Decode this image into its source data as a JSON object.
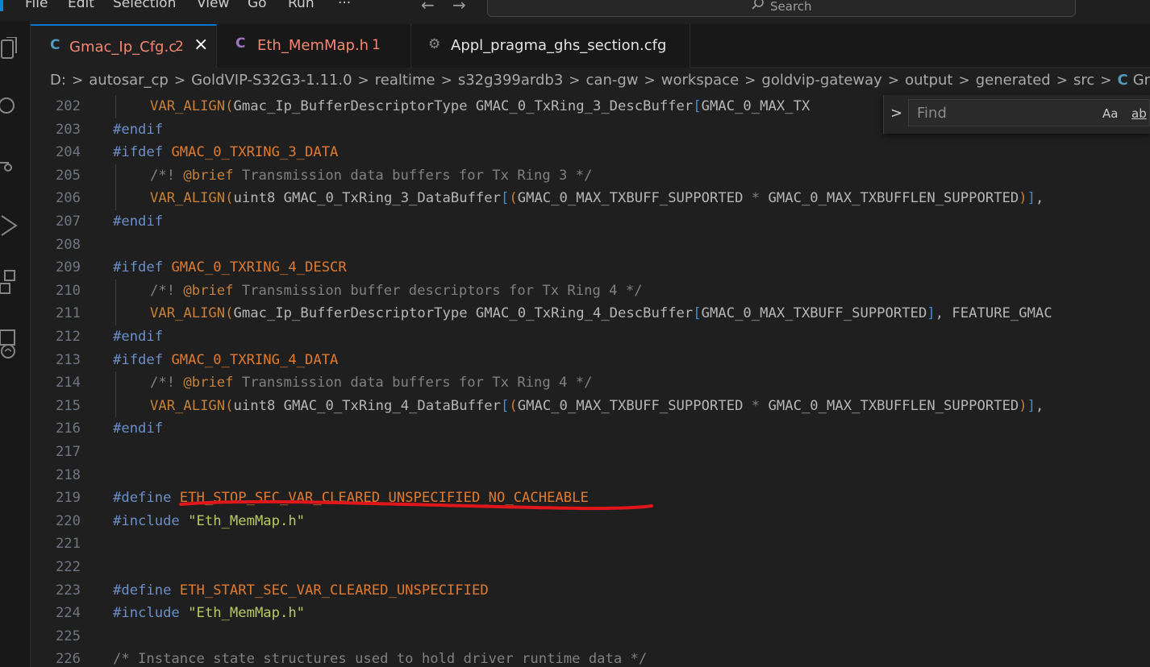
{
  "menu": [
    "File",
    "Edit",
    "Selection",
    "View",
    "Go",
    "Run",
    "···"
  ],
  "search": {
    "placeholder": "Search"
  },
  "tabs": [
    {
      "icon": "C",
      "label": "Gmac_Ip_Cfg.c",
      "count": "2",
      "active": true,
      "color": "#f48771"
    },
    {
      "icon": "C",
      "label": "Eth_MemMap.h",
      "count": "1",
      "active": false,
      "color": "#f48771"
    },
    {
      "icon": "gear",
      "label": "Appl_pragma_ghs_section.cfg",
      "count": "",
      "active": false,
      "color": "#cccccc"
    }
  ],
  "breadcrumb": [
    "D:",
    "autosar_cp",
    "GoldVIP-S32G3-1.11.0",
    "realtime",
    "s32g399ardb3",
    "can-gw",
    "workspace",
    "goldvip-gateway",
    "output",
    "generated",
    "src",
    "Gmac_Ip_Cfg"
  ],
  "find": {
    "placeholder": "Find",
    "opt_case": "Aa",
    "opt_word": "ab"
  },
  "lines": [
    {
      "n": "202",
      "indent": true,
      "t": "VAR_ALIGN(Gmac_Ip_BufferDescriptorType GMAC_0_TxRing_3_DescBuffer[GMAC_0_MAX_TX"
    },
    {
      "n": "203",
      "indent": false,
      "t": "#endif"
    },
    {
      "n": "204",
      "indent": false,
      "t": "#ifdef GMAC_0_TXRING_3_DATA"
    },
    {
      "n": "205",
      "indent": true,
      "t": "/*! @brief Transmission data buffers for Tx Ring 3 */"
    },
    {
      "n": "206",
      "indent": true,
      "t": "VAR_ALIGN(uint8 GMAC_0_TxRing_3_DataBuffer[(GMAC_0_MAX_TXBUFF_SUPPORTED * GMAC_0_MAX_TXBUFFLEN_SUPPORTED)],"
    },
    {
      "n": "207",
      "indent": false,
      "t": "#endif"
    },
    {
      "n": "208",
      "indent": false,
      "t": ""
    },
    {
      "n": "209",
      "indent": false,
      "t": "#ifdef GMAC_0_TXRING_4_DESCR"
    },
    {
      "n": "210",
      "indent": true,
      "t": "/*! @brief Transmission buffer descriptors for Tx Ring 4 */"
    },
    {
      "n": "211",
      "indent": true,
      "t": "VAR_ALIGN(Gmac_Ip_BufferDescriptorType GMAC_0_TxRing_4_DescBuffer[GMAC_0_MAX_TXBUFF_SUPPORTED], FEATURE_GMAC"
    },
    {
      "n": "212",
      "indent": false,
      "t": "#endif"
    },
    {
      "n": "213",
      "indent": false,
      "t": "#ifdef GMAC_0_TXRING_4_DATA"
    },
    {
      "n": "214",
      "indent": true,
      "t": "/*! @brief Transmission data buffers for Tx Ring 4 */"
    },
    {
      "n": "215",
      "indent": true,
      "t": "VAR_ALIGN(uint8 GMAC_0_TxRing_4_DataBuffer[(GMAC_0_MAX_TXBUFF_SUPPORTED * GMAC_0_MAX_TXBUFFLEN_SUPPORTED)],"
    },
    {
      "n": "216",
      "indent": false,
      "t": "#endif"
    },
    {
      "n": "217",
      "indent": false,
      "t": ""
    },
    {
      "n": "218",
      "indent": false,
      "t": ""
    },
    {
      "n": "219",
      "indent": false,
      "t": "#define ETH_STOP_SEC_VAR_CLEARED_UNSPECIFIED_NO_CACHEABLE"
    },
    {
      "n": "220",
      "indent": false,
      "t": "#include \"Eth_MemMap.h\""
    },
    {
      "n": "221",
      "indent": false,
      "t": ""
    },
    {
      "n": "222",
      "indent": false,
      "t": ""
    },
    {
      "n": "223",
      "indent": false,
      "t": "#define ETH_START_SEC_VAR_CLEARED_UNSPECIFIED"
    },
    {
      "n": "224",
      "indent": false,
      "t": "#include \"Eth_MemMap.h\""
    },
    {
      "n": "225",
      "indent": false,
      "t": ""
    },
    {
      "n": "226",
      "indent": false,
      "t": "/* Instance state structures used to hold driver runtime data */"
    }
  ],
  "colors": {
    "annotation": "#e0161b",
    "accent": "#0078d4",
    "c_icon": "#519aba"
  }
}
